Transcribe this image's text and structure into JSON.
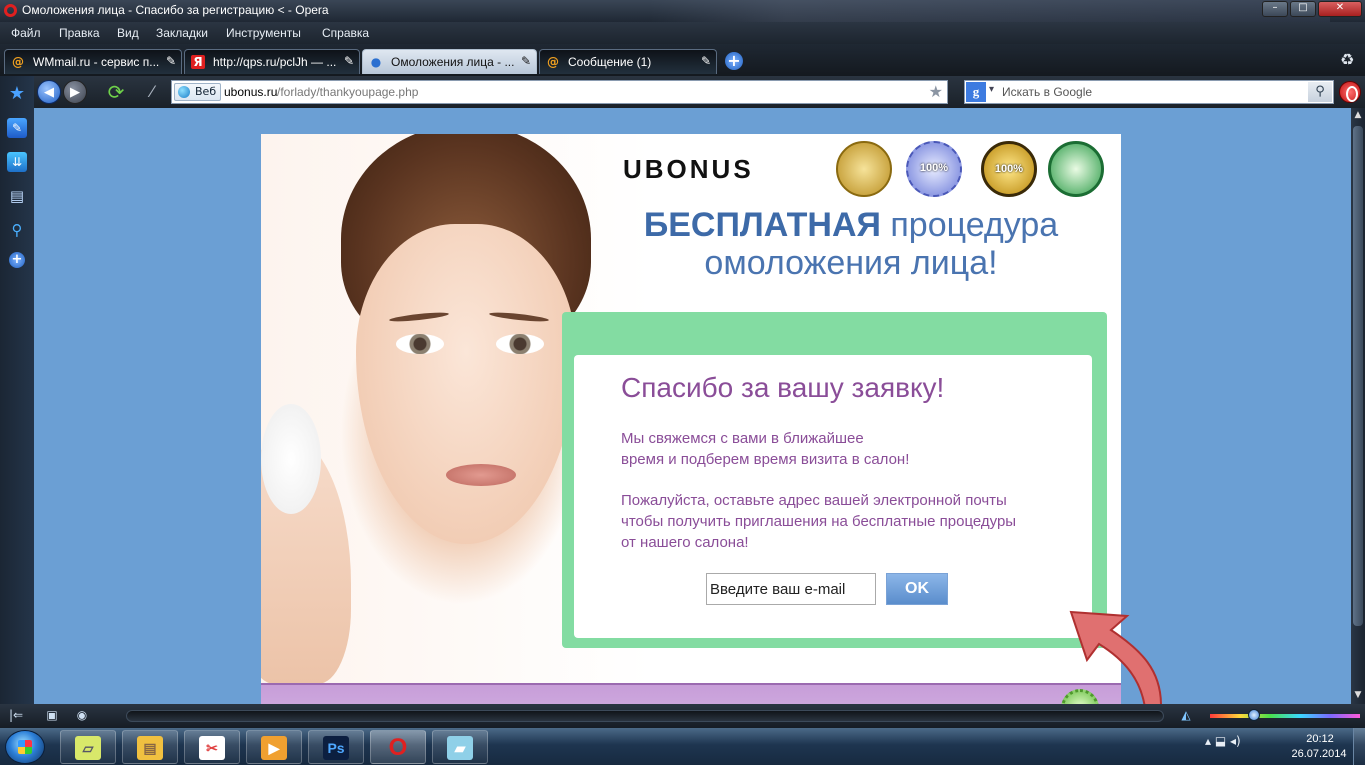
{
  "window": {
    "title": "Омоложения лица - Спасибо за регистрацию < - Opera",
    "controls": {
      "minimize": "–",
      "maximize": "□",
      "close": "✕"
    }
  },
  "menu": [
    "Файл",
    "Правка",
    "Вид",
    "Закладки",
    "Инструменты",
    "Справка"
  ],
  "tabs": [
    {
      "label": "WMmail.ru - сервис п...",
      "favicon": "@",
      "favicon_icon": "at-sign-icon",
      "close": "✎",
      "active": false
    },
    {
      "label": "http://qps.ru/pclJh — ...",
      "favicon": "Я",
      "favicon_icon": "yandex-icon",
      "close": "✎",
      "active": false
    },
    {
      "label": "Омоложения лица - ...",
      "favicon": "●",
      "favicon_icon": "globe-icon",
      "close": "✎",
      "active": true
    },
    {
      "label": "Сообщение (1)",
      "favicon": "@",
      "favicon_icon": "at-sign-icon",
      "close": "✎",
      "active": false
    }
  ],
  "new_tab_glyph": "+",
  "trash_glyph": "♻",
  "toolbar": {
    "back_glyph": "◀",
    "forward_glyph": "▶",
    "reload_glyph": "⟳",
    "wand_glyph": "⁄",
    "address": {
      "badge": "Веб",
      "host": "ubonus.ru",
      "path": "/forlady/thankyoupage.php",
      "star": "★"
    },
    "search": {
      "engine_glyph": "g",
      "caret": "▾",
      "placeholder": "Искать в Google",
      "button_glyph": "⚲"
    }
  },
  "left_panel": {
    "star": "★",
    "notes": "✎",
    "downloads": "⇊",
    "panels": "▤",
    "search": "⚲",
    "add": "+"
  },
  "scrollbar": {
    "up": "▲",
    "down": "▼"
  },
  "page": {
    "brand": "UBONUS",
    "badges": [
      "",
      "100%",
      "100%",
      ""
    ],
    "headline_bold": "БЕСПЛАТНАЯ",
    "headline_rest1": " процедура",
    "headline_rest2": "омоложения лица!",
    "thanks_title": "Спасибо за вашу заявку!",
    "thanks_p1": "Мы свяжемся с вами в ближайшее\nвремя и подберем время визита в салон!",
    "thanks_p2": "Пожалуйста, оставьте адрес вашей электронной почты\nчтобы получить приглашения на бесплатные процедуры\nот нашего салона!",
    "email_placeholder": "Введите ваш e-mail",
    "ok_label": "OK"
  },
  "statusbar": {
    "icon1": "|⇐",
    "icon2": "▣",
    "icon3": "◉",
    "icon4": "◭"
  },
  "taskbar": {
    "buttons": [
      {
        "name": "taskbar-notes",
        "glyph": "▱",
        "color": "#d8e86a"
      },
      {
        "name": "taskbar-explorer",
        "glyph": "▤",
        "color": "#f0c040"
      },
      {
        "name": "taskbar-scissors",
        "glyph": "✂",
        "color": "#e04040"
      },
      {
        "name": "taskbar-media",
        "glyph": "▶",
        "color": "#f0a030"
      },
      {
        "name": "taskbar-photoshop",
        "glyph": "Ps",
        "color": "#2a7bd8"
      },
      {
        "name": "taskbar-opera",
        "glyph": "O",
        "color": "#e02020"
      },
      {
        "name": "taskbar-edit",
        "glyph": "▰",
        "color": "#8fd0e8"
      }
    ],
    "tray_glyphs": "▴  ⬓  ◂)",
    "time": "20:12",
    "date": "26.07.2014"
  }
}
